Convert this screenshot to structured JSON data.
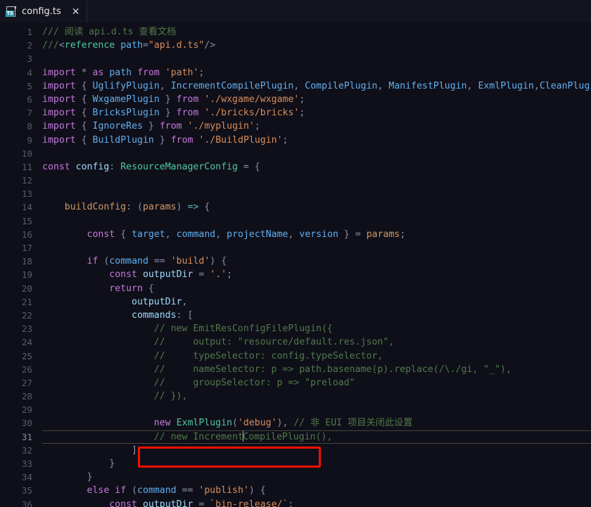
{
  "window": {
    "app": "code-editor",
    "background_color": "#0f0f19"
  },
  "tabbar": {
    "tabs": [
      {
        "label": "config.ts",
        "icon": "typescript-file-icon",
        "badge_text": "TS",
        "badge_color": "#2e9ab0",
        "close_label": "✕",
        "active": true
      }
    ]
  },
  "editor": {
    "language": "typescript",
    "active_line": 31,
    "cursor_column_text": "// new Increment|CompilePlugin(),",
    "annotation": {
      "type": "red-rectangle-highlight",
      "color": "#fa0f00",
      "target_line": 31
    },
    "lines": [
      {
        "n": 1,
        "text": "/// 阅读 api.d.ts 查看文档"
      },
      {
        "n": 2,
        "text": "///<reference path=\"api.d.ts\"/>"
      },
      {
        "n": 3,
        "text": ""
      },
      {
        "n": 4,
        "text": "import * as path from 'path';"
      },
      {
        "n": 5,
        "text": "import { UglifyPlugin, IncrementCompilePlugin, CompilePlugin, ManifestPlugin, ExmlPlugin,CleanPlugin,"
      },
      {
        "n": 6,
        "text": "import { WxgamePlugin } from './wxgame/wxgame';"
      },
      {
        "n": 7,
        "text": "import { BricksPlugin } from './bricks/bricks';"
      },
      {
        "n": 8,
        "text": "import { IgnoreRes } from './myplugin';"
      },
      {
        "n": 9,
        "text": "import { BuildPlugin } from './BuildPlugin';"
      },
      {
        "n": 10,
        "text": ""
      },
      {
        "n": 11,
        "text": "const config: ResourceManagerConfig = {"
      },
      {
        "n": 12,
        "text": ""
      },
      {
        "n": 13,
        "text": ""
      },
      {
        "n": 14,
        "text": "    buildConfig: (params) => {"
      },
      {
        "n": 15,
        "text": ""
      },
      {
        "n": 16,
        "text": "        const { target, command, projectName, version } = params;"
      },
      {
        "n": 17,
        "text": ""
      },
      {
        "n": 18,
        "text": "        if (command == 'build') {"
      },
      {
        "n": 19,
        "text": "            const outputDir = '.';"
      },
      {
        "n": 20,
        "text": "            return {"
      },
      {
        "n": 21,
        "text": "                outputDir,"
      },
      {
        "n": 22,
        "text": "                commands: ["
      },
      {
        "n": 23,
        "text": "                    // new EmitResConfigFilePlugin({"
      },
      {
        "n": 24,
        "text": "                    //     output: \"resource/default.res.json\","
      },
      {
        "n": 25,
        "text": "                    //     typeSelector: config.typeSelector,"
      },
      {
        "n": 26,
        "text": "                    //     nameSelector: p => path.basename(p).replace(/\\./gi, \"_\"),"
      },
      {
        "n": 27,
        "text": "                    //     groupSelector: p => \"preload\""
      },
      {
        "n": 28,
        "text": "                    // }),"
      },
      {
        "n": 29,
        "text": ""
      },
      {
        "n": 30,
        "text": "                    new ExmlPlugin('debug'), // 非 EUI 项目关闭此设置"
      },
      {
        "n": 31,
        "text": "                    // new IncrementCompilePlugin(),"
      },
      {
        "n": 32,
        "text": "                ]"
      },
      {
        "n": 33,
        "text": "            }"
      },
      {
        "n": 34,
        "text": "        }"
      },
      {
        "n": 35,
        "text": "        else if (command == 'publish') {"
      },
      {
        "n": 36,
        "text": "            const outputDir = `bin-release/`;"
      }
    ]
  },
  "colors": {
    "keyword": "#c678dd",
    "identifier": "#61afef",
    "string": "#d98e5a",
    "comment": "#4f7a4a",
    "type": "#4ec9a0",
    "variable": "#d19a66",
    "punctuation": "#8a90a8",
    "gutter": "#5a5a6e",
    "annotation": "#fa0f00"
  }
}
